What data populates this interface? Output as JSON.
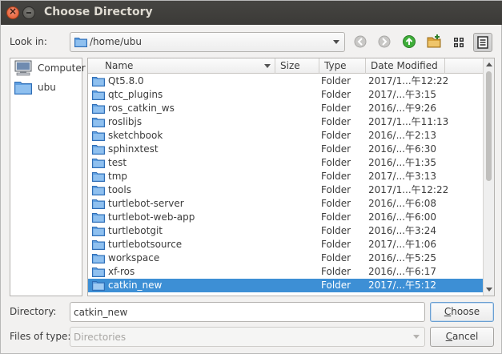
{
  "window": {
    "title": "Choose Directory"
  },
  "look_in": {
    "label": "Look in:",
    "path": "/home/ubu"
  },
  "toolbar": {
    "back_icon": "arrow-left-icon",
    "forward_icon": "arrow-right-icon",
    "parent_icon": "arrow-up-icon",
    "new_folder_icon": "new-folder-icon",
    "list_view_icon": "list-view-icon",
    "detail_view_icon": "detail-view-icon"
  },
  "sidebar": {
    "items": [
      {
        "label": "Computer",
        "icon": "computer-icon"
      },
      {
        "label": "ubu",
        "icon": "folder-icon"
      }
    ]
  },
  "columns": {
    "name": "Name",
    "size": "Size",
    "type": "Type",
    "date": "Date Modified"
  },
  "files": [
    {
      "name": "Qt5.8.0",
      "type": "Folder",
      "date": "2017/1...午12:22"
    },
    {
      "name": "qtc_plugins",
      "type": "Folder",
      "date": "2017/...午3:15"
    },
    {
      "name": "ros_catkin_ws",
      "type": "Folder",
      "date": "2016/...午9:26"
    },
    {
      "name": "roslibjs",
      "type": "Folder",
      "date": "2017/1...午11:13"
    },
    {
      "name": "sketchbook",
      "type": "Folder",
      "date": "2016/...午2:13"
    },
    {
      "name": "sphinxtest",
      "type": "Folder",
      "date": "2016/...午6:30"
    },
    {
      "name": "test",
      "type": "Folder",
      "date": "2016/...午1:35"
    },
    {
      "name": "tmp",
      "type": "Folder",
      "date": "2017/...午3:13"
    },
    {
      "name": "tools",
      "type": "Folder",
      "date": "2017/1...午12:22"
    },
    {
      "name": "turtlebot-server",
      "type": "Folder",
      "date": "2016/...午6:08"
    },
    {
      "name": "turtlebot-web-app",
      "type": "Folder",
      "date": "2016/...午6:00"
    },
    {
      "name": "turtlebotgit",
      "type": "Folder",
      "date": "2016/...午3:24"
    },
    {
      "name": "turtlebotsource",
      "type": "Folder",
      "date": "2017/...午1:06"
    },
    {
      "name": "workspace",
      "type": "Folder",
      "date": "2016/...午5:25"
    },
    {
      "name": "xf-ros",
      "type": "Folder",
      "date": "2016/...午6:17"
    },
    {
      "name": "catkin_new",
      "type": "Folder",
      "date": "2017/...午5:12",
      "selected": true
    }
  ],
  "directory": {
    "label": "Directory:",
    "value": "catkin_new"
  },
  "files_of_type": {
    "label": "Files of type:",
    "value": "Directories"
  },
  "buttons": {
    "choose": "Choose",
    "cancel": "Cancel"
  },
  "colors": {
    "selection": "#3d8fd5",
    "folder": "#4a90d9",
    "titlebar": "#3b3a37"
  }
}
